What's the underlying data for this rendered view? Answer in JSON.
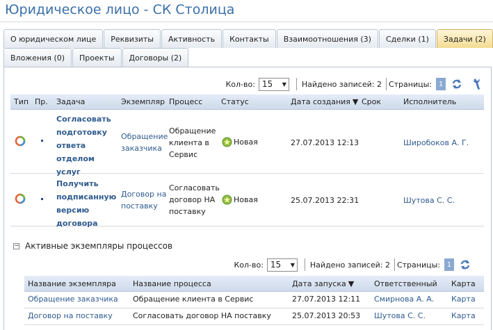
{
  "header": {
    "title": "Юридическое лицо - СК Столица"
  },
  "tabs_row1": [
    {
      "label": "О юридическом лице",
      "active": false
    },
    {
      "label": "Реквизиты",
      "active": false
    },
    {
      "label": "Активность",
      "active": false
    },
    {
      "label": "Контакты",
      "active": false
    },
    {
      "label": "Взаимоотношения (3)",
      "active": false
    },
    {
      "label": "Сделки (1)",
      "active": false
    },
    {
      "label": "Задачи (2)",
      "active": true
    }
  ],
  "tabs_row2": [
    {
      "label": "Вложения (0)"
    },
    {
      "label": "Проекты"
    },
    {
      "label": "Договоры (2)"
    }
  ],
  "tasks_toolbar": {
    "count_label": "Кол-во:",
    "count_value": "15",
    "found_label": "Найдено записей: 2",
    "pages_label": "Страницы:",
    "page": "1"
  },
  "tasks_table": {
    "columns": {
      "type": "Тип",
      "priority": "Пр.",
      "task": "Задача",
      "instance": "Экземпляр",
      "process": "Процесс",
      "status": "Статус",
      "created": "Дата создания",
      "deadline": "Срок",
      "executor": "Исполнитель"
    },
    "rows": [
      {
        "task_lines": [
          "Согласовать",
          "подготовку",
          "ответа",
          "отделом",
          "услуг"
        ],
        "instance_lines": [
          "Обращение",
          "заказчика"
        ],
        "process_lines": [
          "Обращение",
          "клиента в",
          "Сервис"
        ],
        "status": "Новая",
        "created": "27.07.2013 12:13",
        "deadline": "",
        "executor": "Широбоков А. Г."
      },
      {
        "task_lines": [
          "Получить",
          "подписанную",
          "версию",
          "договора"
        ],
        "instance_lines": [
          "Договор на",
          "поставку"
        ],
        "process_lines": [
          "Согласовать",
          "договор НА",
          "поставку"
        ],
        "status": "Новая",
        "created": "25.07.2013 22:31",
        "deadline": "",
        "executor": "Шутова С. С."
      }
    ]
  },
  "processes_section": {
    "title": "Активные экземпляры процессов"
  },
  "processes_toolbar": {
    "count_label": "Кол-во:",
    "count_value": "15",
    "found_label": "Найдено записей: 2",
    "pages_label": "Страницы:",
    "page": "1"
  },
  "processes_table": {
    "columns": {
      "instance_name": "Название экземпляра",
      "process_name": "Название процесса",
      "start_date": "Дата запуска",
      "responsible": "Ответственный",
      "card": "Карта"
    },
    "rows": [
      {
        "instance_name": "Обращение заказчика",
        "process_name": "Обращение клиента в Сервис",
        "start_date": "27.07.2013 12:11",
        "responsible": "Смирнова А. А.",
        "card": "Карта"
      },
      {
        "instance_name": "Договор на поставку",
        "process_name": "Согласовать договор НА поставку",
        "start_date": "25.07.2013 20:53",
        "responsible": "Шутова С. С.",
        "card": "Карта"
      }
    ]
  },
  "colors": {
    "accent": "#3b6fa8",
    "link": "#2f5b8f",
    "active_tab": "#f3dc92",
    "header_bg": "#d6e1ef",
    "status_icon": "#8fbf3f"
  }
}
